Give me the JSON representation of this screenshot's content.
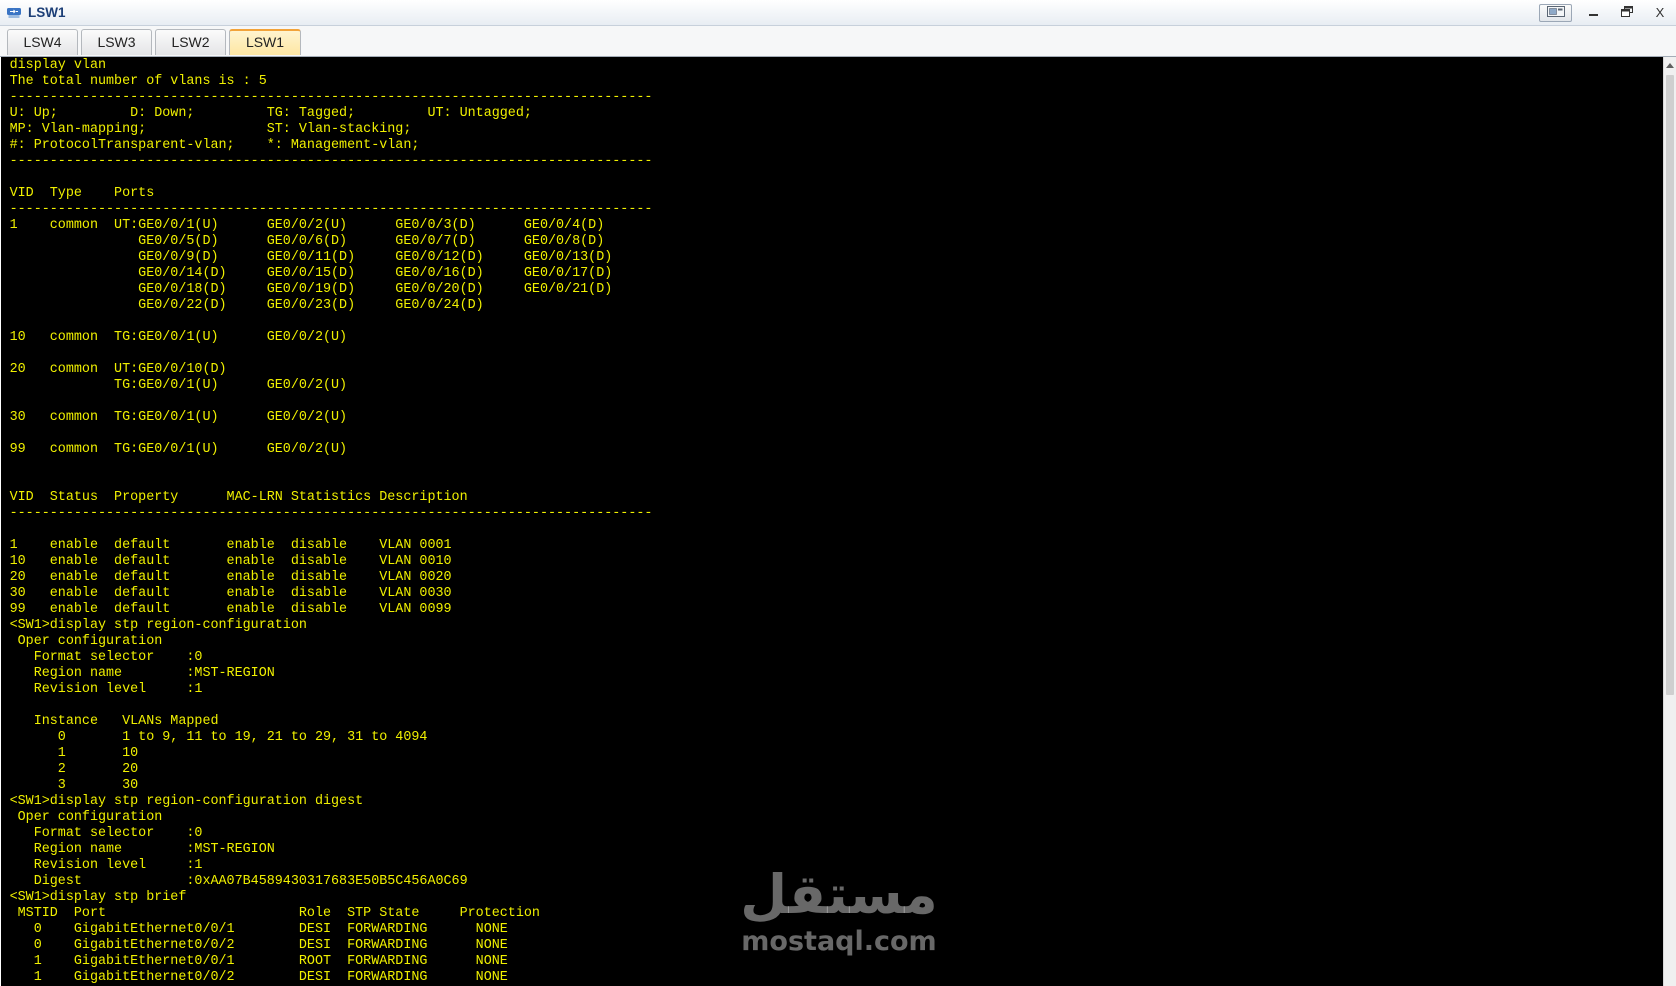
{
  "window": {
    "title": "LSW1",
    "close_label": "X"
  },
  "icons": {
    "app": "network-switch-icon",
    "layout": "window-layout-icon",
    "minimize": "minimize-icon",
    "maximize": "restore-window-icon",
    "scroll_up": "scroll-up-arrow-icon"
  },
  "tabs": [
    {
      "label": "LSW4",
      "active": false
    },
    {
      "label": "LSW3",
      "active": false
    },
    {
      "label": "LSW2",
      "active": false
    },
    {
      "label": "LSW1",
      "active": true
    }
  ],
  "terminal": {
    "lines": [
      "display vlan",
      "The total number of vlans is : 5",
      "--------------------------------------------------------------------------------",
      "U: Up;         D: Down;         TG: Tagged;         UT: Untagged;",
      "MP: Vlan-mapping;               ST: Vlan-stacking;",
      "#: ProtocolTransparent-vlan;    *: Management-vlan;",
      "--------------------------------------------------------------------------------",
      "",
      "VID  Type    Ports",
      "--------------------------------------------------------------------------------",
      "1    common  UT:GE0/0/1(U)      GE0/0/2(U)      GE0/0/3(D)      GE0/0/4(D)",
      "                GE0/0/5(D)      GE0/0/6(D)      GE0/0/7(D)      GE0/0/8(D)",
      "                GE0/0/9(D)      GE0/0/11(D)     GE0/0/12(D)     GE0/0/13(D)",
      "                GE0/0/14(D)     GE0/0/15(D)     GE0/0/16(D)     GE0/0/17(D)",
      "                GE0/0/18(D)     GE0/0/19(D)     GE0/0/20(D)     GE0/0/21(D)",
      "                GE0/0/22(D)     GE0/0/23(D)     GE0/0/24(D)",
      "",
      "10   common  TG:GE0/0/1(U)      GE0/0/2(U)",
      "",
      "20   common  UT:GE0/0/10(D)",
      "             TG:GE0/0/1(U)      GE0/0/2(U)",
      "",
      "30   common  TG:GE0/0/1(U)      GE0/0/2(U)",
      "",
      "99   common  TG:GE0/0/1(U)      GE0/0/2(U)",
      "",
      "",
      "VID  Status  Property      MAC-LRN Statistics Description",
      "--------------------------------------------------------------------------------",
      "",
      "1    enable  default       enable  disable    VLAN 0001",
      "10   enable  default       enable  disable    VLAN 0010",
      "20   enable  default       enable  disable    VLAN 0020",
      "30   enable  default       enable  disable    VLAN 0030",
      "99   enable  default       enable  disable    VLAN 0099",
      "<SW1>display stp region-configuration",
      " Oper configuration",
      "   Format selector    :0",
      "   Region name        :MST-REGION",
      "   Revision level     :1",
      "",
      "   Instance   VLANs Mapped",
      "      0       1 to 9, 11 to 19, 21 to 29, 31 to 4094",
      "      1       10",
      "      2       20",
      "      3       30",
      "<SW1>display stp region-configuration digest",
      " Oper configuration",
      "   Format selector    :0",
      "   Region name        :MST-REGION",
      "   Revision level     :1",
      "   Digest             :0xAA07B4589430317683E50B5C456A0C69",
      "<SW1>display stp brief",
      " MSTID  Port                        Role  STP State     Protection",
      "   0    GigabitEthernet0/0/1        DESI  FORWARDING      NONE",
      "   0    GigabitEthernet0/0/2        DESI  FORWARDING      NONE",
      "   1    GigabitEthernet0/0/1        ROOT  FORWARDING      NONE",
      "   1    GigabitEthernet0/0/2        DESI  FORWARDING      NONE"
    ]
  },
  "watermark": {
    "arabic": "مستقل",
    "latin": "mostaql.com"
  },
  "colors": {
    "terminal_background": "#000000",
    "terminal_text": "#f0f000",
    "active_tab": "#fde6a3",
    "active_tab_accent": "#f2a33a",
    "title_text": "#1d3f77"
  }
}
